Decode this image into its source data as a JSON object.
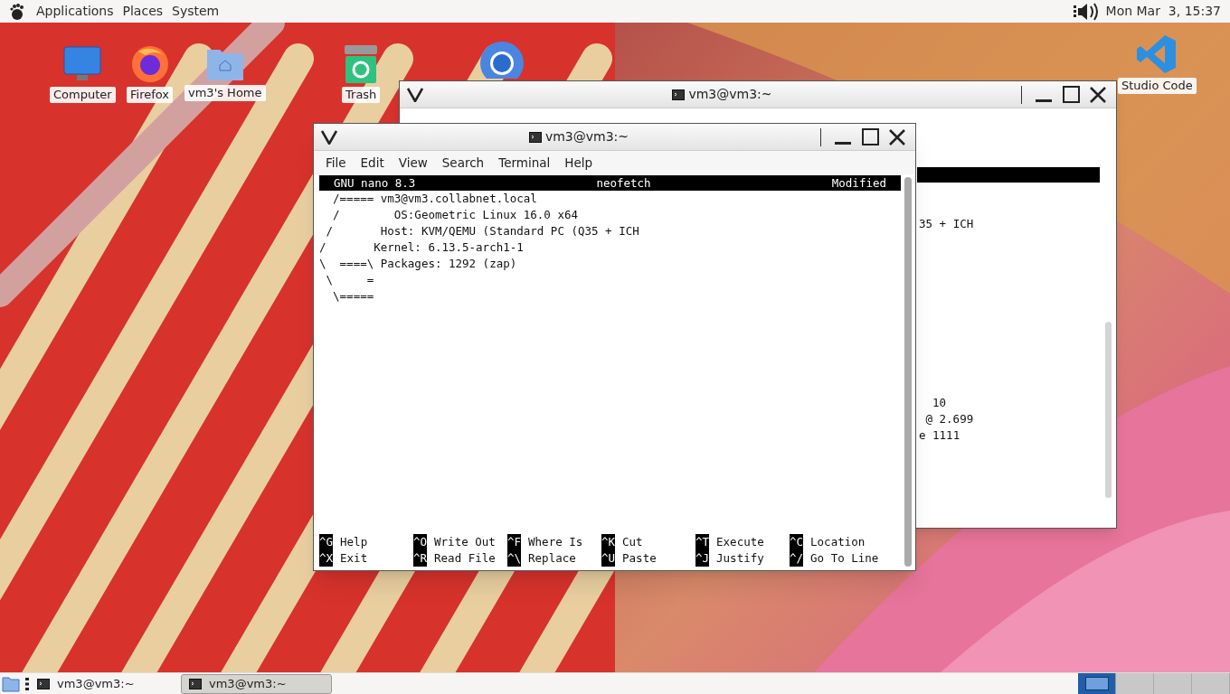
{
  "top_panel": {
    "menus": [
      "Applications",
      "Places",
      "System"
    ],
    "clock": "Mon Mar  3, 15:37"
  },
  "desktop_icons": [
    {
      "kind": "computer",
      "label": "Computer"
    },
    {
      "kind": "firefox",
      "label": "Firefox"
    },
    {
      "kind": "home",
      "label": "vm3's Home"
    },
    {
      "kind": "trash",
      "label": "Trash"
    },
    {
      "kind": "chrome"
    },
    {
      "kind": "vscode",
      "label": "Studio Code"
    }
  ],
  "back_window": {
    "title": "vm3@vm3:~",
    "visible_text": [
      "35 + ICH",
      "10",
      "@ 2.699",
      "e 1111"
    ]
  },
  "front_window": {
    "title": "vm3@vm3:~",
    "menu": [
      "File",
      "Edit",
      "View",
      "Search",
      "Terminal",
      "Help"
    ],
    "nano": {
      "version": "GNU nano 8.3",
      "file": "neofetch",
      "status": "Modified",
      "lines": [
        "  /===== vm3@vm3.collabnet.local",
        "  /        OS:Geometric Linux 16.0 x64",
        " /       Host: KVM/QEMU (Standard PC (Q35 + ICH",
        "/       Kernel: 6.13.5-arch1-1",
        "\\  ====\\ Packages: 1292 (zap)",
        " \\     =",
        "  \\====="
      ],
      "shortcuts": [
        [
          {
            "key": "^G",
            "label": "Help"
          },
          {
            "key": "^X",
            "label": "Exit"
          }
        ],
        [
          {
            "key": "^O",
            "label": "Write Out"
          },
          {
            "key": "^R",
            "label": "Read File"
          }
        ],
        [
          {
            "key": "^F",
            "label": "Where Is"
          },
          {
            "key": "^\\",
            "label": "Replace"
          }
        ],
        [
          {
            "key": "^K",
            "label": "Cut"
          },
          {
            "key": "^U",
            "label": "Paste"
          }
        ],
        [
          {
            "key": "^T",
            "label": "Execute"
          },
          {
            "key": "^J",
            "label": "Justify"
          }
        ],
        [
          {
            "key": "^C",
            "label": "Location"
          },
          {
            "key": "^/",
            "label": "Go To Line"
          }
        ]
      ]
    }
  },
  "taskbar": {
    "tasks": [
      {
        "label": "vm3@vm3:~",
        "selected": false
      },
      {
        "label": "vm3@vm3:~",
        "selected": true
      }
    ],
    "workspaces": [
      {
        "selected": true
      },
      {
        "selected": false
      },
      {
        "selected": false
      },
      {
        "selected": false
      }
    ]
  }
}
